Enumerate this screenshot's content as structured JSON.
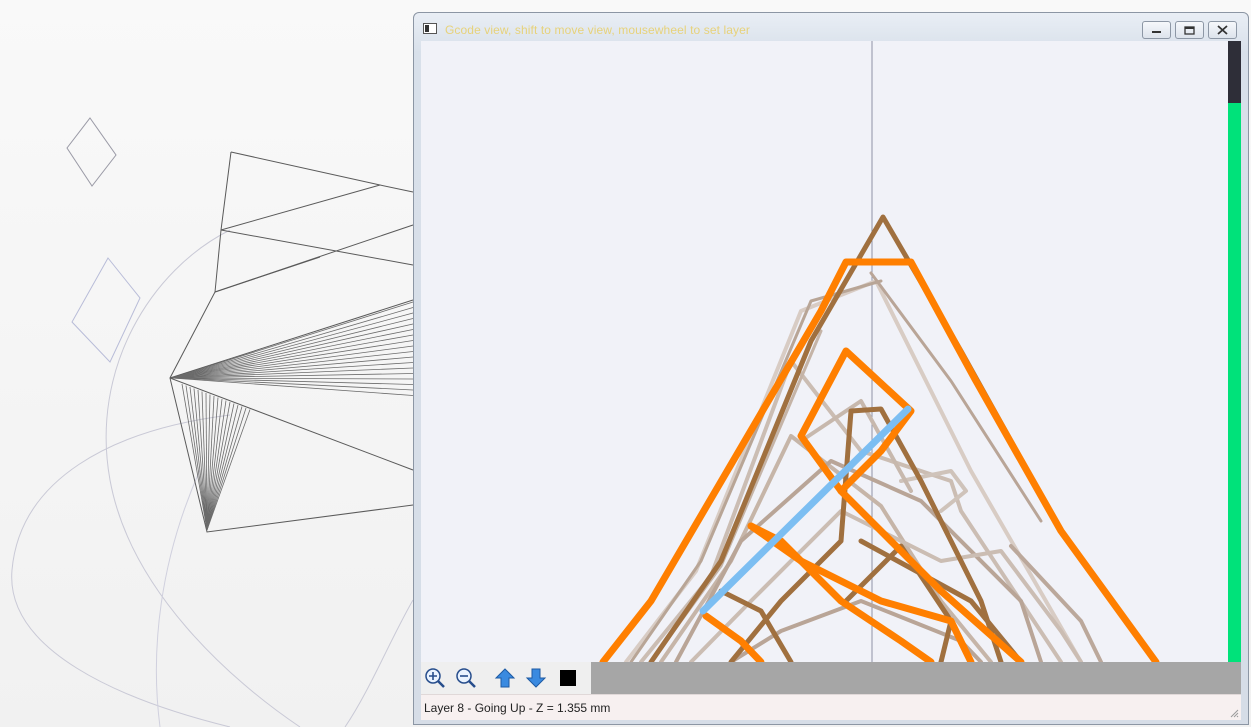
{
  "window": {
    "title": "Gcode view, shift to move view, mousewheel to set layer",
    "controls": [
      "minimize",
      "maximize",
      "close"
    ]
  },
  "toolbar": {
    "tools": [
      {
        "name": "zoom-in-icon"
      },
      {
        "name": "zoom-out-icon"
      },
      {
        "name": "layer-up-icon"
      },
      {
        "name": "layer-down-icon"
      },
      {
        "name": "color-swatch-icon"
      }
    ]
  },
  "status": {
    "text": "Layer 8 - Going Up - Z = 1.355 mm"
  },
  "layer_slider": {
    "fill_fraction": 0.9
  },
  "colors": {
    "current_layer": "#ff7f00",
    "previous_layer": "#a0703f",
    "travel_move": "#7cbef2",
    "slider_fill": "#00e27a",
    "slider_track": "#2e2e38",
    "title_text": "#e7d27a"
  }
}
